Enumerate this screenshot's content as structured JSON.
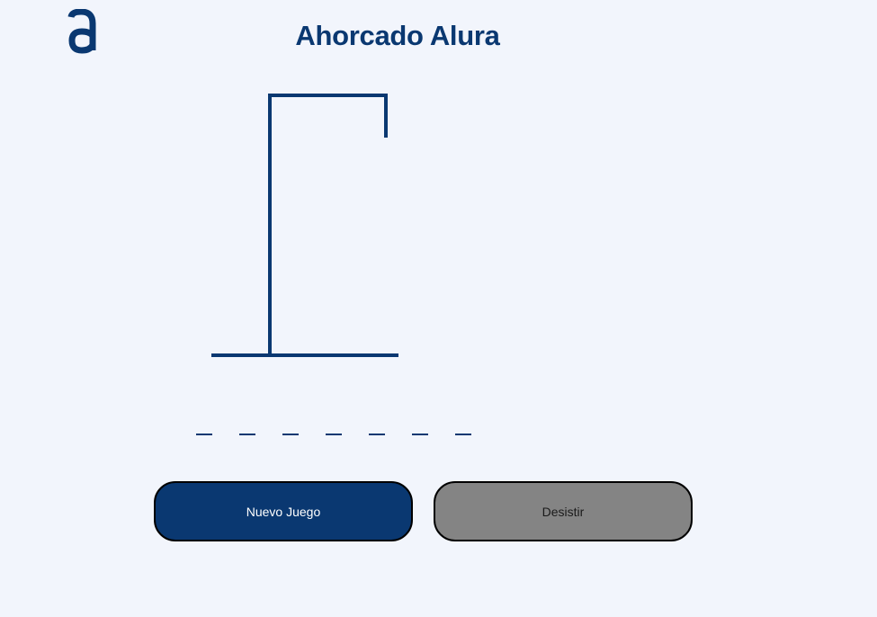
{
  "header": {
    "logo_icon": "alura-a-logo",
    "title": "Ahorcado Alura"
  },
  "game": {
    "word_length": 7,
    "guessed_letters": [
      "",
      "",
      "",
      "",
      "",
      "",
      ""
    ],
    "gallows_icon": "hangman-gallows"
  },
  "actions": {
    "new_game_label": "Nuevo Juego",
    "quit_label": "Desistir"
  },
  "colors": {
    "background": "#F2F5FC",
    "primary": "#0A3871",
    "secondary_button": "#848484"
  }
}
